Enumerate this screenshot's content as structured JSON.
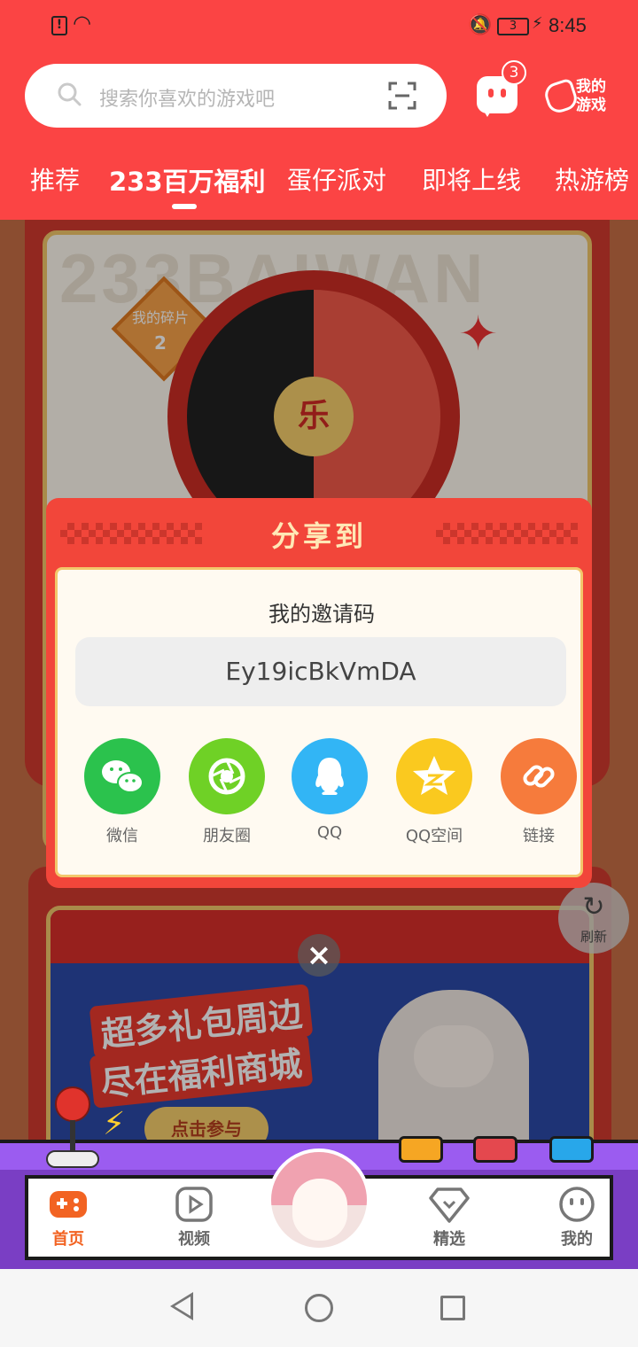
{
  "status_bar": {
    "time": "8:45",
    "battery": "3",
    "sim_icon": "sim-alert-icon"
  },
  "search": {
    "placeholder": "搜索你喜欢的游戏吧"
  },
  "header": {
    "message_badge": "3",
    "my_games_label": "我的游戏"
  },
  "tabs": [
    {
      "label": "推荐"
    },
    {
      "label": "233百万福利",
      "active": true
    },
    {
      "label": "蛋仔派对"
    },
    {
      "label": "即将上线"
    },
    {
      "label": "热游榜"
    }
  ],
  "background": {
    "banner_text": "233BAIWAN",
    "fragments_label": "我的碎片",
    "fragments_count": "2",
    "wheel_center": "乐",
    "promo_line1": "超多礼包周边",
    "promo_line2": "尽在福利商城",
    "promo_button": "点击参与"
  },
  "refresh_label": "刷新",
  "share_modal": {
    "title": "分享到",
    "invite_label": "我的邀请码",
    "invite_code": "Ey19icBkVmDA",
    "targets": [
      {
        "label": "微信",
        "icon": "wechat-icon",
        "color": "#2bc24d"
      },
      {
        "label": "朋友圈",
        "icon": "moments-icon",
        "color": "#6fd126"
      },
      {
        "label": "QQ",
        "icon": "qq-icon",
        "color": "#32b5f5"
      },
      {
        "label": "QQ空间",
        "icon": "qzone-icon",
        "color": "#fac91f"
      },
      {
        "label": "链接",
        "icon": "link-icon",
        "color": "#f67b3c"
      }
    ]
  },
  "bottom_nav": [
    {
      "label": "首页",
      "icon": "gamepad-icon",
      "active": true
    },
    {
      "label": "视频",
      "icon": "video-icon"
    },
    {
      "label": "精选",
      "icon": "heart-badge-icon"
    },
    {
      "label": "我的",
      "icon": "face-icon"
    }
  ],
  "colors": {
    "brand": "#fb4444",
    "active_nav": "#f26322"
  }
}
